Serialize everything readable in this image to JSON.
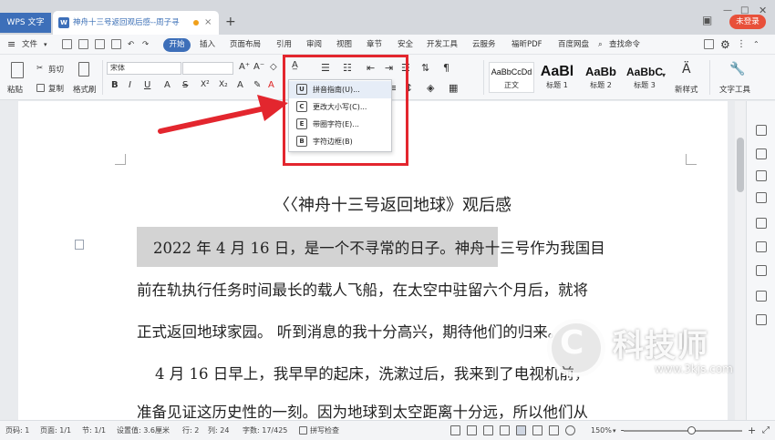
{
  "titlebar": {
    "app_tab": "WPS 文字",
    "doc_tab": "神舟十三号返回观后感--周子寻",
    "login": "未登录"
  },
  "menubar": {
    "file": "文件",
    "tabs": [
      "开始",
      "插入",
      "页面布局",
      "引用",
      "审阅",
      "视图",
      "章节",
      "安全",
      "开发工具",
      "云服务",
      "福昕PDF",
      "百度网盘"
    ],
    "search": "查找命令"
  },
  "ribbon": {
    "paste": "粘贴",
    "cut": "剪切",
    "copy": "复制",
    "format_painter": "格式刷",
    "font_name": "宋体",
    "font_size": "",
    "style_samples": [
      "AaBbCcDd",
      "AaBl",
      "AaBb",
      "AaBbC"
    ],
    "style_names": [
      "正文",
      "标题 1",
      "标题 2",
      "标题 3"
    ],
    "new_style": "新样式",
    "text_tools": "文字工具"
  },
  "dropdown": {
    "items": [
      {
        "icon": "U",
        "label": "拼音指南(U)..."
      },
      {
        "icon": "C",
        "label": "更改大小写(C)..."
      },
      {
        "icon": "E",
        "label": "带圈字符(E)..."
      },
      {
        "icon": "B",
        "label": "字符边框(B)"
      }
    ]
  },
  "document": {
    "title": "〈〈神舟十三号返回地球》观后感",
    "lines": [
      "2022 年 4 月 16 日，是一个不寻常的日子。神舟十三号作为我国目",
      "前在轨执行任务时间最长的载人飞船，在太空中驻留六个月后，就将",
      "正式返回地球家园。 听到消息的我十分高兴，期待他们的归来。",
      "4 月 16 日早上，我早早的起床，洗漱过后，我来到了电视机前，",
      "准备见证这历史性的一刻。因为地球到太空距离十分远，所以他们从"
    ]
  },
  "watermark": {
    "text": "科技师",
    "url": "www.3kjs.com"
  },
  "statusbar": {
    "page_num": "页码: 1",
    "pages": "页面: 1/1",
    "section": "节: 1/1",
    "setting": "设置值: 3.6厘米",
    "row": "行: 2",
    "col": "列: 24",
    "words": "字数: 17/425",
    "spell": "拼写检查",
    "zoom": "150%"
  },
  "colors": {
    "accent": "#3d6fb9",
    "annotation_red": "#e3262e",
    "login_red": "#e8503a"
  }
}
